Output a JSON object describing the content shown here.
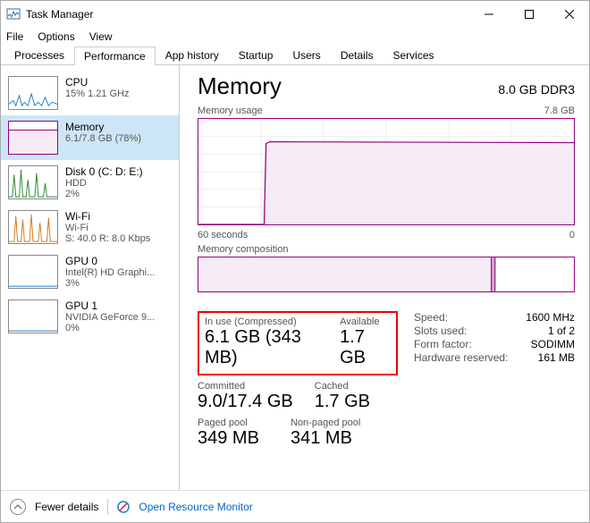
{
  "titlebar": {
    "title": "Task Manager"
  },
  "menubar": {
    "file": "File",
    "options": "Options",
    "view": "View"
  },
  "tabs": {
    "processes": "Processes",
    "performance": "Performance",
    "app_history": "App history",
    "startup": "Startup",
    "users": "Users",
    "details": "Details",
    "services": "Services"
  },
  "sidebar": {
    "items": [
      {
        "title": "CPU",
        "l2": "15% 1.21 GHz",
        "l3": ""
      },
      {
        "title": "Memory",
        "l2": "6.1/7.8 GB (78%)",
        "l3": ""
      },
      {
        "title": "Disk 0 (C: D: E:)",
        "l2": "HDD",
        "l3": "2%"
      },
      {
        "title": "Wi-Fi",
        "l2": "Wi-Fi",
        "l3": "S: 40.0 R: 8.0 Kbps"
      },
      {
        "title": "GPU 0",
        "l2": "Intel(R) HD Graphi...",
        "l3": "3%"
      },
      {
        "title": "GPU 1",
        "l2": "NVIDIA GeForce 9...",
        "l3": "0%"
      }
    ]
  },
  "main": {
    "title": "Memory",
    "capacity": "8.0 GB DDR3",
    "usage_label": "Memory usage",
    "usage_max": "7.8 GB",
    "axis_left": "60 seconds",
    "axis_right": "0",
    "comp_label": "Memory composition",
    "stats": {
      "inuse_label": "In use (Compressed)",
      "inuse_value": "6.1 GB (343 MB)",
      "avail_label": "Available",
      "avail_value": "1.7 GB",
      "committed_label": "Committed",
      "committed_value": "9.0/17.4 GB",
      "cached_label": "Cached",
      "cached_value": "1.7 GB",
      "paged_label": "Paged pool",
      "paged_value": "349 MB",
      "nonpaged_label": "Non-paged pool",
      "nonpaged_value": "341 MB"
    },
    "kv": {
      "speed_k": "Speed:",
      "speed_v": "1600 MHz",
      "slots_k": "Slots used:",
      "slots_v": "1 of 2",
      "form_k": "Form factor:",
      "form_v": "SODIMM",
      "hw_k": "Hardware reserved:",
      "hw_v": "161 MB"
    }
  },
  "footer": {
    "fewer": "Fewer details",
    "resmon": "Open Resource Monitor"
  },
  "chart_data": [
    {
      "type": "line",
      "title": "Memory usage",
      "x_label": "60 seconds → 0",
      "ylim": [
        0,
        7.8
      ],
      "y_unit": "GB",
      "series": [
        {
          "name": "In use",
          "values_before_step": 0,
          "values_after_step": 6.1,
          "step_at_fraction": 0.18
        }
      ]
    },
    {
      "type": "bar",
      "title": "Memory composition",
      "total": 7.8,
      "segments": [
        {
          "name": "In use",
          "value": 6.1
        },
        {
          "name": "Modified",
          "value": 0.05
        },
        {
          "name": "Standby/Free",
          "value": 1.65
        }
      ]
    }
  ]
}
